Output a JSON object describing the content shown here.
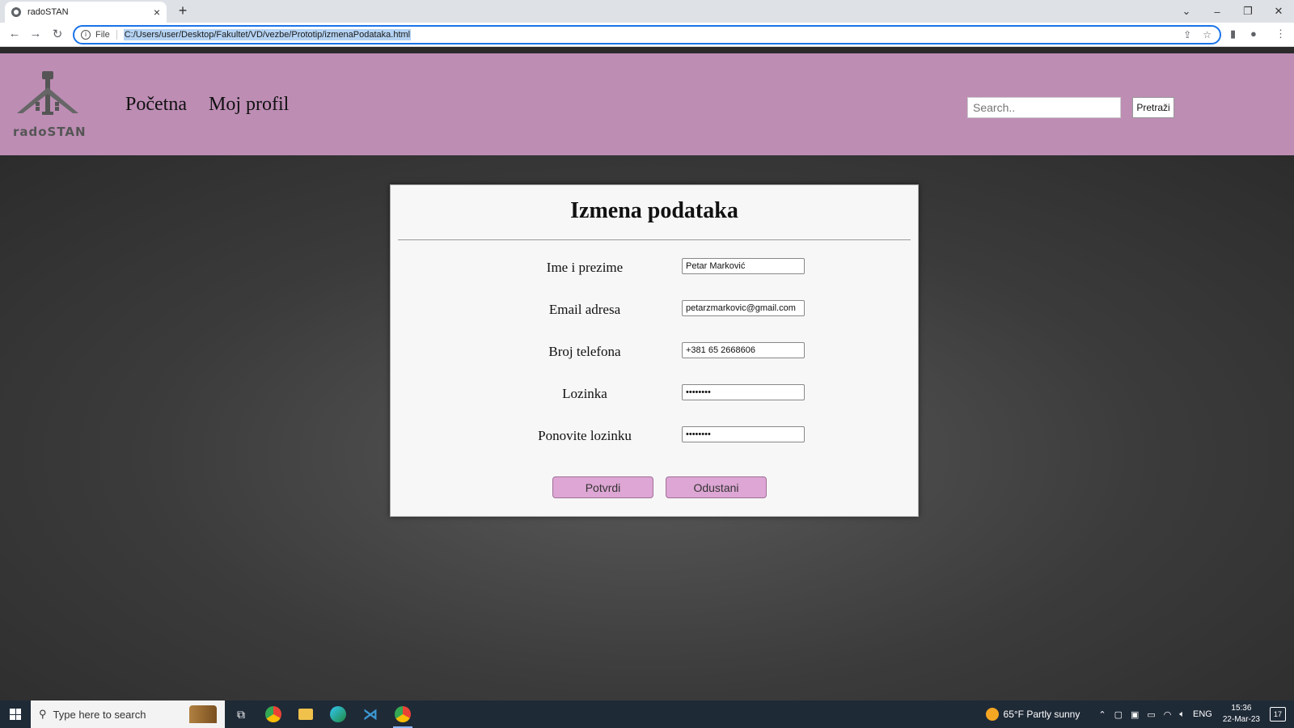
{
  "browser": {
    "tab_title": "radoSTAN",
    "tab_close": "×",
    "new_tab": "+",
    "file_label": "File",
    "url": "C:/Users/user/Desktop/Fakultet/VD/vezbe/Prototip/izmenaPodataka.html",
    "window_controls": {
      "dropdown": "⌄",
      "minimize": "–",
      "restore": "❐",
      "close": "✕"
    }
  },
  "header": {
    "brand": "radoSTAN",
    "nav": [
      "Početna",
      "Moj profil"
    ],
    "search_placeholder": "Search..",
    "search_button": "Pretraži",
    "bg_color": "#bd8db4"
  },
  "form": {
    "title": "Izmena podataka",
    "fields": [
      {
        "label": "Ime i prezime",
        "value": "Petar Marković",
        "type": "text"
      },
      {
        "label": "Email adresa",
        "value": "petarzmarkovic@gmail.com",
        "type": "text"
      },
      {
        "label": "Broj telefona",
        "value": "+381 65 2668606",
        "type": "text"
      },
      {
        "label": "Lozinka",
        "value": "••••••••",
        "type": "password"
      },
      {
        "label": "Ponovite lozinku",
        "value": "••••••••",
        "type": "password"
      }
    ],
    "confirm_button": "Potvrdi",
    "cancel_button": "Odustani",
    "button_color": "#dda6d4"
  },
  "taskbar": {
    "search_placeholder": "Type here to search",
    "weather": "65°F  Partly sunny",
    "language": "ENG",
    "time": "15:36",
    "date": "22-Mar-23",
    "notifications": "17"
  }
}
